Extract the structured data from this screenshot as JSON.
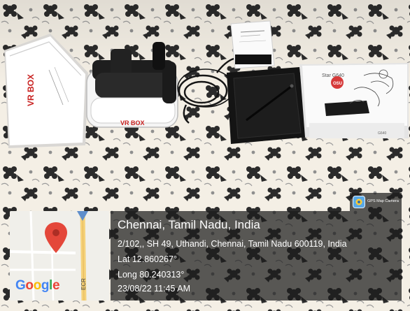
{
  "photo": {
    "vr_box_label": "VR BOX",
    "tablet_box_brand": "Star G640",
    "tablet_box_badge": "OSU"
  },
  "gps_overlay": {
    "app_badge": "GPS Map Camera",
    "location_title": "Chennai, Tamil Nadu, India",
    "address": "2/102,, SH 49, Uthandi, Chennai, Tamil Nadu 600119, India",
    "latitude": "Lat 12.860267°",
    "longitude": "Long 80.240313°",
    "datetime": "23/08/22 11:45 AM",
    "map_road_label": "ECR",
    "map_logo": "Google"
  },
  "colors": {
    "panel_bg": "#1c1c1c",
    "map_pin": "#e4473a",
    "road_yellow": "#f5d27a",
    "google_blue": "#4285F4",
    "google_red": "#EA4335",
    "google_yellow": "#FBBC05",
    "google_green": "#34A853"
  }
}
